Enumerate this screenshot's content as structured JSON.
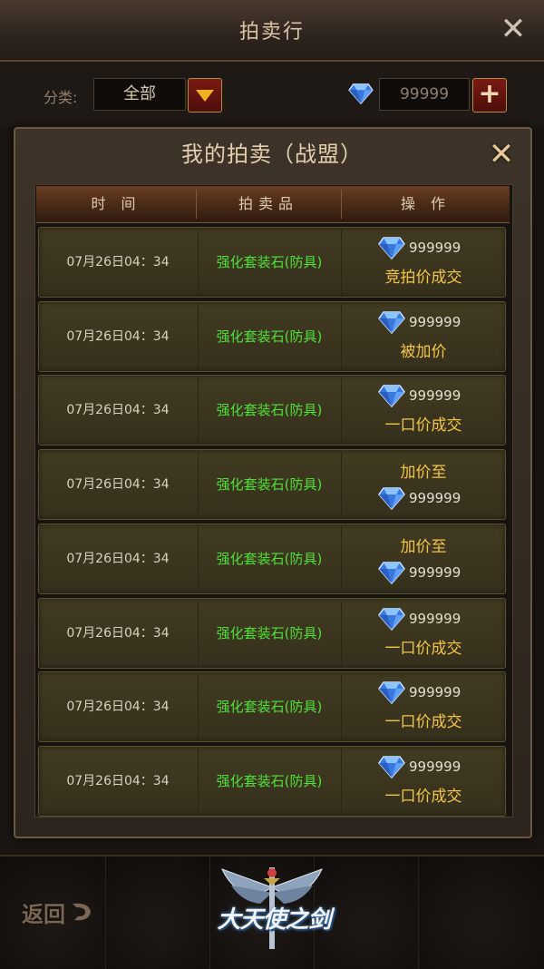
{
  "header": {
    "title": "拍卖行"
  },
  "filter": {
    "category_label": "分类:",
    "category_value": "全部",
    "currency_amount": "99999"
  },
  "dialog": {
    "title": "我的拍卖（战盟）",
    "columns": [
      "时 间",
      "拍卖品",
      "操 作"
    ],
    "rows": [
      {
        "time": "07月26日04：34",
        "item": "强化套装石(防具)",
        "price": "999999",
        "status": "竞拍价成交",
        "price_first": true
      },
      {
        "time": "07月26日04：34",
        "item": "强化套装石(防具)",
        "price": "999999",
        "status": "被加价",
        "price_first": true
      },
      {
        "time": "07月26日04：34",
        "item": "强化套装石(防具)",
        "price": "999999",
        "status": "一口价成交",
        "price_first": true
      },
      {
        "time": "07月26日04：34",
        "item": "强化套装石(防具)",
        "price": "999999",
        "status": "加价至",
        "price_first": false
      },
      {
        "time": "07月26日04：34",
        "item": "强化套装石(防具)",
        "price": "999999",
        "status": "加价至",
        "price_first": false
      },
      {
        "time": "07月26日04：34",
        "item": "强化套装石(防具)",
        "price": "999999",
        "status": "一口价成交",
        "price_first": true
      },
      {
        "time": "07月26日04：34",
        "item": "强化套装石(防具)",
        "price": "999999",
        "status": "一口价成交",
        "price_first": true
      },
      {
        "time": "07月26日04：34",
        "item": "强化套装石(防具)",
        "price": "999999",
        "status": "一口价成交",
        "price_first": true
      }
    ]
  },
  "footer": {
    "back_label": "返回",
    "logo_text": "大天使之剑"
  },
  "colors": {
    "item_green": "#4fe03a",
    "status_gold": "#f2c44a",
    "gem_blue": "#4a8ef0"
  },
  "icons": {
    "close": "close-icon",
    "dropdown": "triangle-down-icon",
    "gem": "diamond-icon",
    "plus": "plus-icon",
    "back": "back-arrow-icon"
  }
}
